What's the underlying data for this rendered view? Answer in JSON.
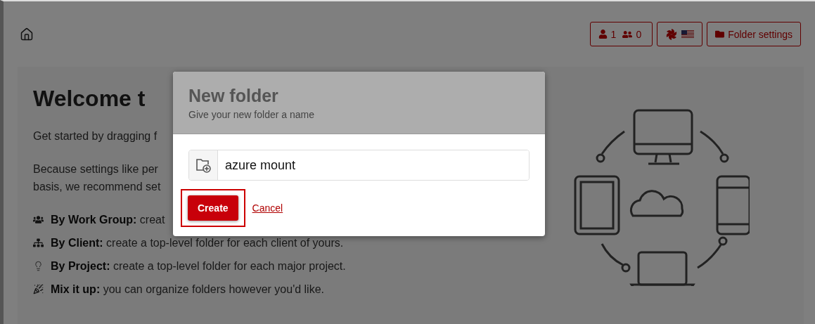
{
  "header": {
    "user_count": "1",
    "group_count": "0",
    "folder_settings_button": "Folder settings"
  },
  "welcome": {
    "title": "Welcome t",
    "lines": [
      "Get started by dragging f",
      "Because settings like per",
      "basis, we recommend set"
    ],
    "tips": [
      {
        "kind": "group",
        "text": "**By Work Group:** creat"
      },
      {
        "kind": "client",
        "text": "**By Client:** create a top-level folder for each client of yours."
      },
      {
        "kind": "project",
        "text": "**By Project:** create a top-level folder for each major project."
      },
      {
        "kind": "mix",
        "text": "**Mix it up:** you can organize folders however you'd like."
      }
    ]
  },
  "dialog": {
    "title": "New folder",
    "subtitle": "Give your new folder a name",
    "input": {
      "value": "azure mount"
    },
    "create_button": "Create",
    "cancel_link": "Cancel"
  }
}
